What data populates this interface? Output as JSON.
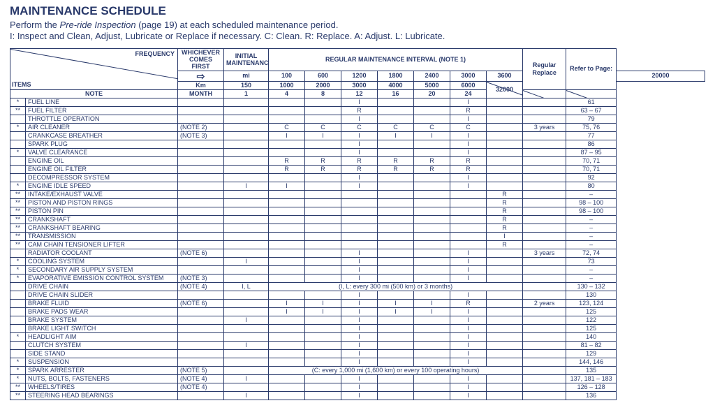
{
  "header": {
    "title": "MAINTENANCE SCHEDULE",
    "subtitle_line1a": "Perform the ",
    "subtitle_line1_italic": "Pre-ride Inspection",
    "subtitle_line1b": " (page 19) at each scheduled maintenance period.",
    "subtitle_line2": "I: Inspect and Clean, Adjust, Lubricate or Replace if necessary. C: Clean. R: Replace. A: Adjust. L: Lubricate."
  },
  "tableHeaders": {
    "frequency": "FREQUENCY",
    "items": "ITEMS",
    "whichever": "WHICHEVER COMES FIRST",
    "arrow": "⇨",
    "note": "NOTE",
    "mi": "mi",
    "km": "Km",
    "month": "MONTH",
    "initial": "INITIAL MAINTENANCE",
    "regular": "REGULAR MAINTENANCE INTERVAL (NOTE 1)",
    "regularReplace": "Regular Replace",
    "referPage": "Refer to Page:",
    "initial_mi": "100",
    "initial_km": "150",
    "initial_month": "1",
    "intervals_mi": [
      "600",
      "1200",
      "1800",
      "2400",
      "3000",
      "3600",
      "20000"
    ],
    "intervals_km": [
      "1000",
      "2000",
      "3000",
      "4000",
      "5000",
      "6000",
      "32000"
    ],
    "intervals_month": [
      "4",
      "8",
      "12",
      "16",
      "20",
      "24",
      ""
    ]
  },
  "rows": [
    {
      "m": "*",
      "item": "FUEL LINE",
      "note": "",
      "init": "",
      "c": [
        "",
        "",
        "I",
        "",
        "",
        "I",
        ""
      ],
      "rr": "",
      "page": "61"
    },
    {
      "m": "**",
      "item": "FUEL FILTER",
      "note": "",
      "init": "",
      "c": [
        "",
        "",
        "R",
        "",
        "",
        "R",
        ""
      ],
      "rr": "",
      "page": "63 – 67"
    },
    {
      "m": "",
      "item": "THROTTLE OPERATION",
      "note": "",
      "init": "",
      "c": [
        "",
        "",
        "I",
        "",
        "",
        "I",
        ""
      ],
      "rr": "",
      "page": "79"
    },
    {
      "m": "*",
      "item": "AIR CLEANER",
      "note": "(NOTE 2)",
      "init": "",
      "c": [
        "C",
        "C",
        "C",
        "C",
        "C",
        "C",
        ""
      ],
      "rr": "3 years",
      "page": "75, 76"
    },
    {
      "m": "",
      "item": "CRANKCASE BREATHER",
      "note": "(NOTE 3)",
      "init": "",
      "c": [
        "I",
        "I",
        "I",
        "I",
        "I",
        "I",
        ""
      ],
      "rr": "",
      "page": "77"
    },
    {
      "m": "",
      "item": "SPARK PLUG",
      "note": "",
      "init": "",
      "c": [
        "",
        "",
        "I",
        "",
        "",
        "I",
        ""
      ],
      "rr": "",
      "page": "86"
    },
    {
      "m": "*",
      "item": "VALVE CLEARANCE",
      "note": "",
      "init": "",
      "c": [
        "",
        "",
        "I",
        "",
        "",
        "I",
        ""
      ],
      "rr": "",
      "page": "87 – 95"
    },
    {
      "m": "",
      "item": "ENGINE OIL",
      "note": "",
      "init": "",
      "c": [
        "R",
        "R",
        "R",
        "R",
        "R",
        "R",
        ""
      ],
      "rr": "",
      "page": "70, 71"
    },
    {
      "m": "",
      "item": "ENGINE OIL FILTER",
      "note": "",
      "init": "",
      "c": [
        "R",
        "R",
        "R",
        "R",
        "R",
        "R",
        ""
      ],
      "rr": "",
      "page": "70, 71"
    },
    {
      "m": "",
      "item": "DECOMPRESSOR SYSTEM",
      "note": "",
      "init": "",
      "c": [
        "",
        "",
        "I",
        "",
        "",
        "I",
        ""
      ],
      "rr": "",
      "page": "92"
    },
    {
      "m": "*",
      "item": "ENGINE IDLE SPEED",
      "note": "",
      "init": "I",
      "c": [
        "I",
        "",
        "I",
        "",
        "",
        "I",
        ""
      ],
      "rr": "",
      "page": "80"
    },
    {
      "m": "**",
      "item": "INTAKE/EXHAUST VALVE",
      "note": "",
      "init": "",
      "c": [
        "",
        "",
        "",
        "",
        "",
        "",
        "R"
      ],
      "rr": "",
      "page": "–"
    },
    {
      "m": "**",
      "item": "PISTON AND PISTON RINGS",
      "note": "",
      "init": "",
      "c": [
        "",
        "",
        "",
        "",
        "",
        "",
        "R"
      ],
      "rr": "",
      "page": "98 – 100"
    },
    {
      "m": "**",
      "item": "PISTON PIN",
      "note": "",
      "init": "",
      "c": [
        "",
        "",
        "",
        "",
        "",
        "",
        "R"
      ],
      "rr": "",
      "page": "98 – 100"
    },
    {
      "m": "**",
      "item": "CRANKSHAFT",
      "note": "",
      "init": "",
      "c": [
        "",
        "",
        "",
        "",
        "",
        "",
        "R"
      ],
      "rr": "",
      "page": "–"
    },
    {
      "m": "**",
      "item": "CRANKSHAFT BEARING",
      "note": "",
      "init": "",
      "c": [
        "",
        "",
        "",
        "",
        "",
        "",
        "R"
      ],
      "rr": "",
      "page": "–"
    },
    {
      "m": "**",
      "item": "TRANSMISSION",
      "note": "",
      "init": "",
      "c": [
        "",
        "",
        "",
        "",
        "",
        "",
        "I"
      ],
      "rr": "",
      "page": "–"
    },
    {
      "m": "**",
      "item": "CAM CHAIN TENSIONER LIFTER",
      "note": "",
      "init": "",
      "c": [
        "",
        "",
        "",
        "",
        "",
        "",
        "R"
      ],
      "rr": "",
      "page": "–"
    },
    {
      "m": "",
      "item": "RADIATOR COOLANT",
      "note": "(NOTE 6)",
      "init": "",
      "c": [
        "",
        "",
        "I",
        "",
        "",
        "I",
        ""
      ],
      "rr": "3 years",
      "page": "72, 74"
    },
    {
      "m": "*",
      "item": "COOLING SYSTEM",
      "note": "",
      "init": "I",
      "c": [
        "",
        "",
        "I",
        "",
        "",
        "I",
        ""
      ],
      "rr": "",
      "page": "73"
    },
    {
      "m": "*",
      "item": "SECONDARY AIR SUPPLY SYSTEM",
      "note": "",
      "init": "",
      "c": [
        "",
        "",
        "I",
        "",
        "",
        "I",
        ""
      ],
      "rr": "",
      "page": "–"
    },
    {
      "m": "*",
      "item": "EVAPORATIVE EMISSION CONTROL SYSTEM",
      "note": "(NOTE 3)",
      "init": "",
      "c": [
        "",
        "",
        "I",
        "",
        "",
        "I",
        ""
      ],
      "rr": "",
      "page": "–"
    },
    {
      "m": "",
      "item": "DRIVE CHAIN",
      "note": "(NOTE 4)",
      "init": "I, L",
      "c": [],
      "span": "(I, L: every 300 mi (500 km) or 3 months)",
      "rr": "",
      "page": "130 – 132"
    },
    {
      "m": "",
      "item": "DRIVE CHAIN SLIDER",
      "note": "",
      "init": "",
      "c": [
        "",
        "",
        "I",
        "",
        "",
        "I",
        ""
      ],
      "rr": "",
      "page": "130"
    },
    {
      "m": "",
      "item": "BRAKE FLUID",
      "note": "(NOTE 6)",
      "init": "",
      "c": [
        "I",
        "I",
        "I",
        "I",
        "I",
        "R",
        ""
      ],
      "rr": "2 years",
      "page": "123, 124"
    },
    {
      "m": "",
      "item": "BRAKE PADS WEAR",
      "note": "",
      "init": "",
      "c": [
        "I",
        "I",
        "I",
        "I",
        "I",
        "I",
        ""
      ],
      "rr": "",
      "page": "125"
    },
    {
      "m": "",
      "item": "BRAKE SYSTEM",
      "note": "",
      "init": "I",
      "c": [
        "",
        "",
        "I",
        "",
        "",
        "I",
        ""
      ],
      "rr": "",
      "page": "122"
    },
    {
      "m": "",
      "item": "BRAKE LIGHT SWITCH",
      "note": "",
      "init": "",
      "c": [
        "",
        "",
        "I",
        "",
        "",
        "I",
        ""
      ],
      "rr": "",
      "page": "125"
    },
    {
      "m": "*",
      "item": "HEADLIGHT AIM",
      "note": "",
      "init": "",
      "c": [
        "",
        "",
        "I",
        "",
        "",
        "I",
        ""
      ],
      "rr": "",
      "page": "140"
    },
    {
      "m": "",
      "item": "CLUTCH SYSTEM",
      "note": "",
      "init": "I",
      "c": [
        "",
        "",
        "I",
        "",
        "",
        "I",
        ""
      ],
      "rr": "",
      "page": "81 – 82"
    },
    {
      "m": "",
      "item": "SIDE STAND",
      "note": "",
      "init": "",
      "c": [
        "",
        "",
        "I",
        "",
        "",
        "I",
        ""
      ],
      "rr": "",
      "page": "129"
    },
    {
      "m": "*",
      "item": "SUSPENSION",
      "note": "",
      "init": "",
      "c": [
        "",
        "",
        "I",
        "",
        "",
        "I",
        ""
      ],
      "rr": "",
      "page": "144, 146"
    },
    {
      "m": "*",
      "item": "SPARK ARRESTER",
      "note": "(NOTE 5)",
      "init": "",
      "c": [],
      "span": "(C: every 1,000 mi (1,600 km) or every 100 operating hours)",
      "rr": "",
      "page": "135"
    },
    {
      "m": "*",
      "item": "NUTS, BOLTS, FASTENERS",
      "note": "(NOTE 4)",
      "init": "I",
      "c": [
        "",
        "",
        "I",
        "",
        "",
        "I",
        ""
      ],
      "rr": "",
      "page": "137, 181 – 183"
    },
    {
      "m": "**",
      "item": "WHEELS/TIRES",
      "note": "(NOTE 4)",
      "init": "",
      "c": [
        "",
        "",
        "I",
        "",
        "",
        "I",
        ""
      ],
      "rr": "",
      "page": "126 – 128"
    },
    {
      "m": "**",
      "item": "STEERING HEAD BEARINGS",
      "note": "",
      "init": "I",
      "c": [
        "",
        "",
        "I",
        "",
        "",
        "I",
        ""
      ],
      "rr": "",
      "page": "136"
    }
  ]
}
